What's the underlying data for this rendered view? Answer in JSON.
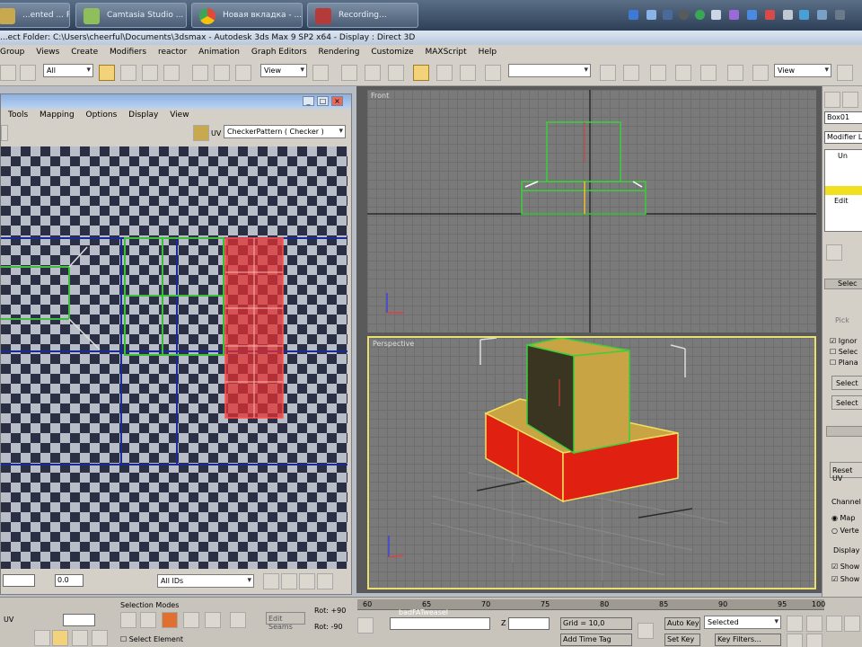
{
  "taskbar": {
    "tasks": [
      {
        "label": "...ented ... Proje..."
      },
      {
        "label": "Camtasia Studio ..."
      },
      {
        "label": "Новая вкладка - ..."
      },
      {
        "label": "Recording..."
      }
    ]
  },
  "app": {
    "title": "...ect Folder: C:\\Users\\cheerful\\Documents\\3dsmax   - Autodesk 3ds Max 9 SP2 x64   - Display : Direct 3D"
  },
  "menu": [
    "Group",
    "Views",
    "Create",
    "Modifiers",
    "reactor",
    "Animation",
    "Graph Editors",
    "Rendering",
    "Customize",
    "MAXScript",
    "Help"
  ],
  "toolbar": {
    "selection_filter": "All",
    "ref_coord": "View",
    "named_selection": "",
    "ref_coord2": "View"
  },
  "uv_editor": {
    "menu": [
      "Tools",
      "Mapping",
      "Options",
      "Display",
      "View"
    ],
    "map_dropdown": "CheckerPattern  ( Checker )",
    "bottom": {
      "u_value": "0.0",
      "filter": "All IDs"
    }
  },
  "viewports": {
    "top_label": "Front",
    "bottom_label": "Perspective"
  },
  "command_panel": {
    "object_name": "Box01",
    "modifier_list": "Modifier Li",
    "stack_items": [
      "Un",
      "Edit"
    ],
    "rollout_select": "Selec",
    "pick_label": "Pick",
    "checkboxes": [
      "Ignor",
      "Selec",
      "Plana"
    ],
    "select_btns": [
      "Select",
      "Select"
    ],
    "reset_btn": "Reset UV",
    "channel_label": "Channel",
    "channel_radios": [
      "Map",
      "Verte"
    ],
    "display_label": "Display",
    "display_checks": [
      "Show",
      "Show"
    ]
  },
  "bottom_bar": {
    "uv_label": "UV",
    "selection_modes": "Selection Modes",
    "select_element": "Select Element",
    "edit_seams": "Edit Seams",
    "rot_label": "Rot: +90",
    "rot2_label": "Rot: -90",
    "timeline_ticks": [
      "60",
      "65",
      "70",
      "75",
      "80",
      "85",
      "90",
      "95",
      "100"
    ],
    "status_text": "badFATweasel",
    "z_label": "Z",
    "grid_label": "Grid = 10,0",
    "add_time_tag": "Add Time Tag",
    "auto_key": "Auto Key",
    "set_key": "Set Key",
    "selected_value": "Selected",
    "key_filters": "Key Filters..."
  }
}
